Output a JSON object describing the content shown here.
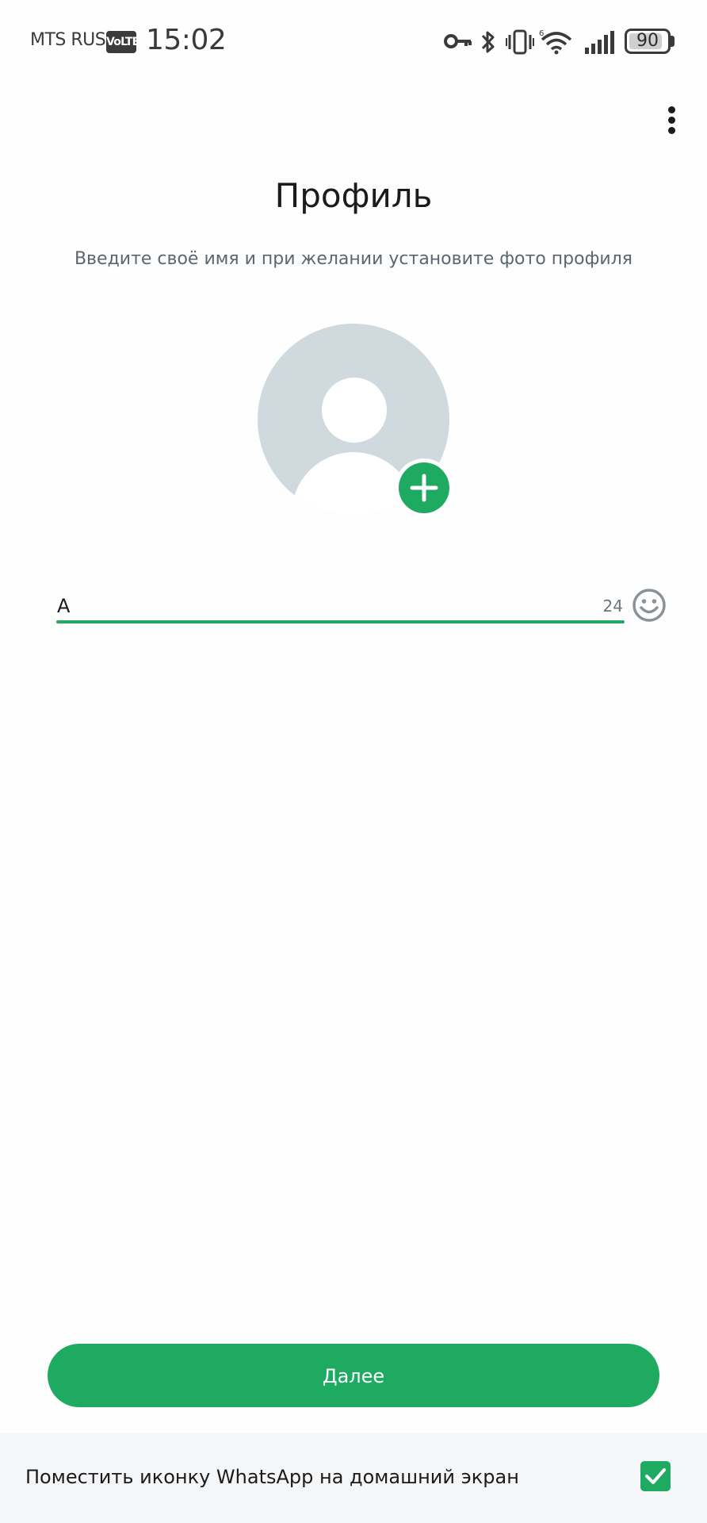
{
  "status_bar": {
    "carrier": "MTS RUS",
    "volte": "VoLTE",
    "time": "15:02",
    "battery_level": "90",
    "battery_fraction": 0.9
  },
  "header": {
    "title": "Профиль",
    "subtitle": "Введите своё имя и при желании установите фото профиля"
  },
  "name_field": {
    "value": "А",
    "counter": "24"
  },
  "actions": {
    "next_label": "Далее"
  },
  "footer": {
    "shortcut_label": "Поместить иконку WhatsApp на домашний экран",
    "shortcut_checked": true
  },
  "colors": {
    "accent": "#1eaa61",
    "avatar_bg": "#cfd9de",
    "footer_bg": "#f5f6f8"
  }
}
